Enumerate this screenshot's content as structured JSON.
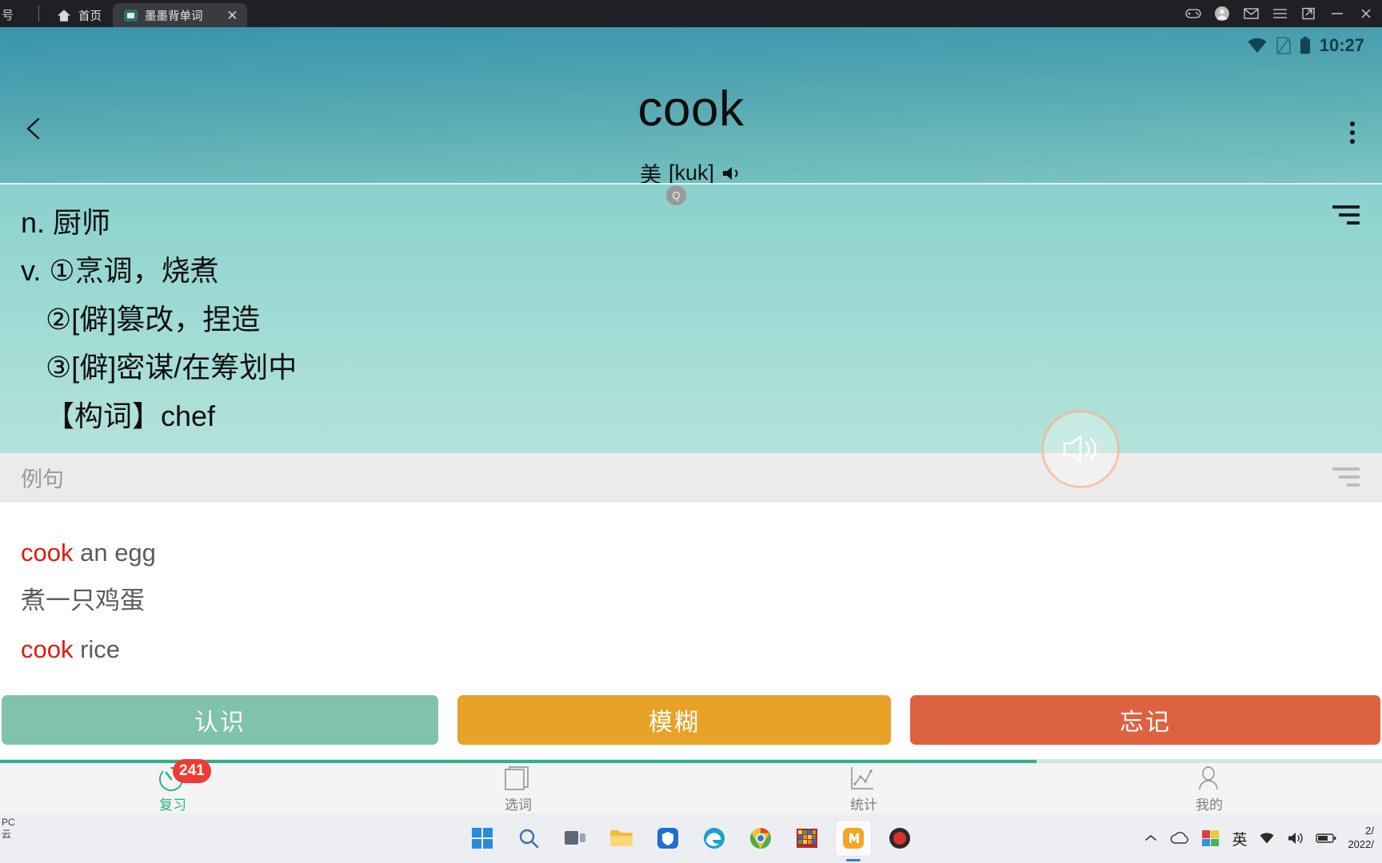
{
  "window": {
    "tabs": [
      {
        "label": "首页",
        "icon": "home-icon",
        "active": false
      },
      {
        "label": "墨墨背单词",
        "icon": "app-icon",
        "active": true,
        "close": "✕"
      }
    ],
    "corner_glyph": "号",
    "controls": [
      {
        "name": "gamepad-icon"
      },
      {
        "name": "account-icon"
      },
      {
        "name": "mail-icon"
      },
      {
        "name": "menu-icon"
      },
      {
        "name": "restore-icon"
      },
      {
        "name": "minimize-icon"
      },
      {
        "name": "close-icon"
      }
    ]
  },
  "status_bar": {
    "time": "10:27",
    "icons": [
      "wifi-icon",
      "sim-card-icon",
      "battery-icon"
    ]
  },
  "header": {
    "word": "cook",
    "accent_label": "美",
    "phonetic": "[kuk]",
    "speaker_icon": "speaker-icon",
    "back_icon": "back-chevron-icon",
    "more_icon": "more-vertical-icon"
  },
  "definition": {
    "sort_icon": "sort-icon",
    "lines": [
      {
        "text": "n. 厨师",
        "indent": false
      },
      {
        "text": "v. ①烹调，烧煮",
        "indent": false
      },
      {
        "text": "②[僻]篡改，捏造",
        "indent": true
      },
      {
        "text": "③[僻]密谋/在筹划中",
        "indent": true
      },
      {
        "text": "【构词】chef",
        "indent": true
      }
    ]
  },
  "examples": {
    "section_title": "例句",
    "sort_icon": "sort-icon",
    "quality_badge": "Q",
    "items": [
      {
        "highlight": "cook",
        "rest": " an egg",
        "translation": "煮一只鸡蛋"
      },
      {
        "highlight": "cook",
        "rest": " rice",
        "translation": ""
      }
    ]
  },
  "audio_fab": {
    "icon": "speaker-wave-icon"
  },
  "actions": [
    {
      "label": "认识",
      "color": "#80c2ac",
      "name": "know-button"
    },
    {
      "label": "模糊",
      "color": "#e8a227",
      "name": "fuzzy-button"
    },
    {
      "label": "忘记",
      "color": "#dd6240",
      "name": "forget-button"
    }
  ],
  "tabbar": {
    "progress_percent": 75,
    "items": [
      {
        "label": "复习",
        "icon": "clock-review-icon",
        "badge": "241",
        "active": true
      },
      {
        "label": "选词",
        "icon": "book-icon",
        "badge": "",
        "active": false
      },
      {
        "label": "统计",
        "icon": "chart-line-icon",
        "badge": "",
        "active": false
      },
      {
        "label": "我的",
        "icon": "person-icon",
        "badge": "",
        "active": false
      }
    ]
  },
  "taskbar": {
    "corner_text": "PC\n云",
    "apps": [
      {
        "name": "start-button-icon"
      },
      {
        "name": "search-icon"
      },
      {
        "name": "task-view-icon"
      },
      {
        "name": "file-explorer-icon"
      },
      {
        "name": "shield-app-icon"
      },
      {
        "name": "edge-legacy-icon"
      },
      {
        "name": "chrome-icon"
      },
      {
        "name": "winrar-icon"
      },
      {
        "name": "mumu-player-icon"
      },
      {
        "name": "record-icon"
      }
    ],
    "tray": {
      "chevron_icon": "chevron-up-icon",
      "cloud_icon": "cloud-icon",
      "color_icon": "color-profile-icon",
      "ime": "英",
      "wifi_icon": "wifi-icon",
      "volume_icon": "volume-icon",
      "battery_icon": "battery-icon",
      "clock_line1": "2/",
      "clock_line2": "2022/"
    }
  }
}
